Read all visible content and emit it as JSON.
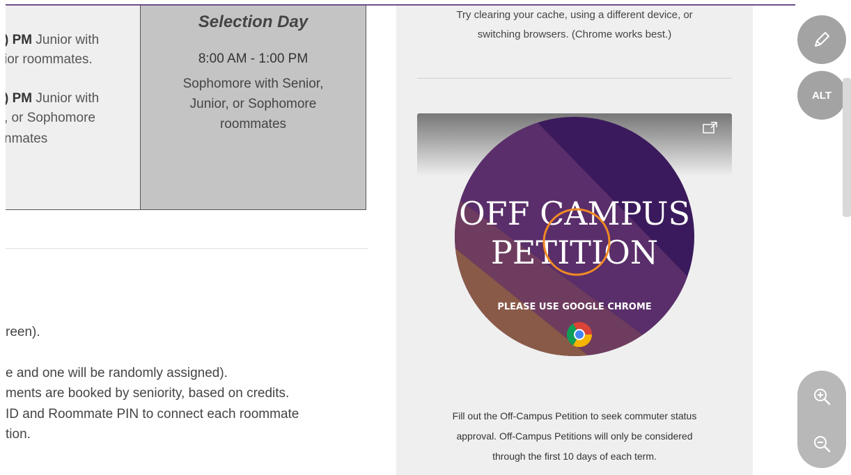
{
  "schedule": {
    "left_cell": {
      "line1_bold": ") PM",
      "line1_text": " Junior with",
      "line2": "ior roommates.",
      "line3_bold": ") PM",
      "line3_text": " Junior with",
      "line4": ", or Sophomore",
      "line5": "nmates"
    },
    "right_cell": {
      "title": "Selection Day",
      "time": "8:00 AM - 1:00 PM",
      "desc_line1": "Sophomore with Senior,",
      "desc_line2": "Junior, or Sophomore",
      "desc_line3": "roommates"
    }
  },
  "body_lines": [
    "reen).",
    "e and one will be randomly assigned).",
    "ments are booked by seniority, based on credits.",
    "ID and Roommate PIN to connect each roommate",
    "tion."
  ],
  "side": {
    "help_line1": "Try clearing your cache, using a different device, or",
    "help_line2": "switching browsers. (Chrome works best.)",
    "promo_title1": "OFF CAMPUS",
    "promo_title2": "PETITION",
    "promo_sub": "PLEASE USE GOOGLE CHROME",
    "petition_line1": "Fill out the Off-Campus Petition to seek commuter status",
    "petition_line2": "approval. Off-Campus Petitions will only be considered",
    "petition_line3": "through the first 10 days of each term."
  },
  "toolbar": {
    "alt_label": "ALT",
    "edit_icon": "pencil-icon",
    "zoom_in_icon": "zoom-in-icon",
    "zoom_out_icon": "zoom-out-icon"
  },
  "colors": {
    "accent_line": "#6b4f86",
    "promo_purple": "#3a1a5c",
    "promo_gold": "#b07a2a"
  }
}
